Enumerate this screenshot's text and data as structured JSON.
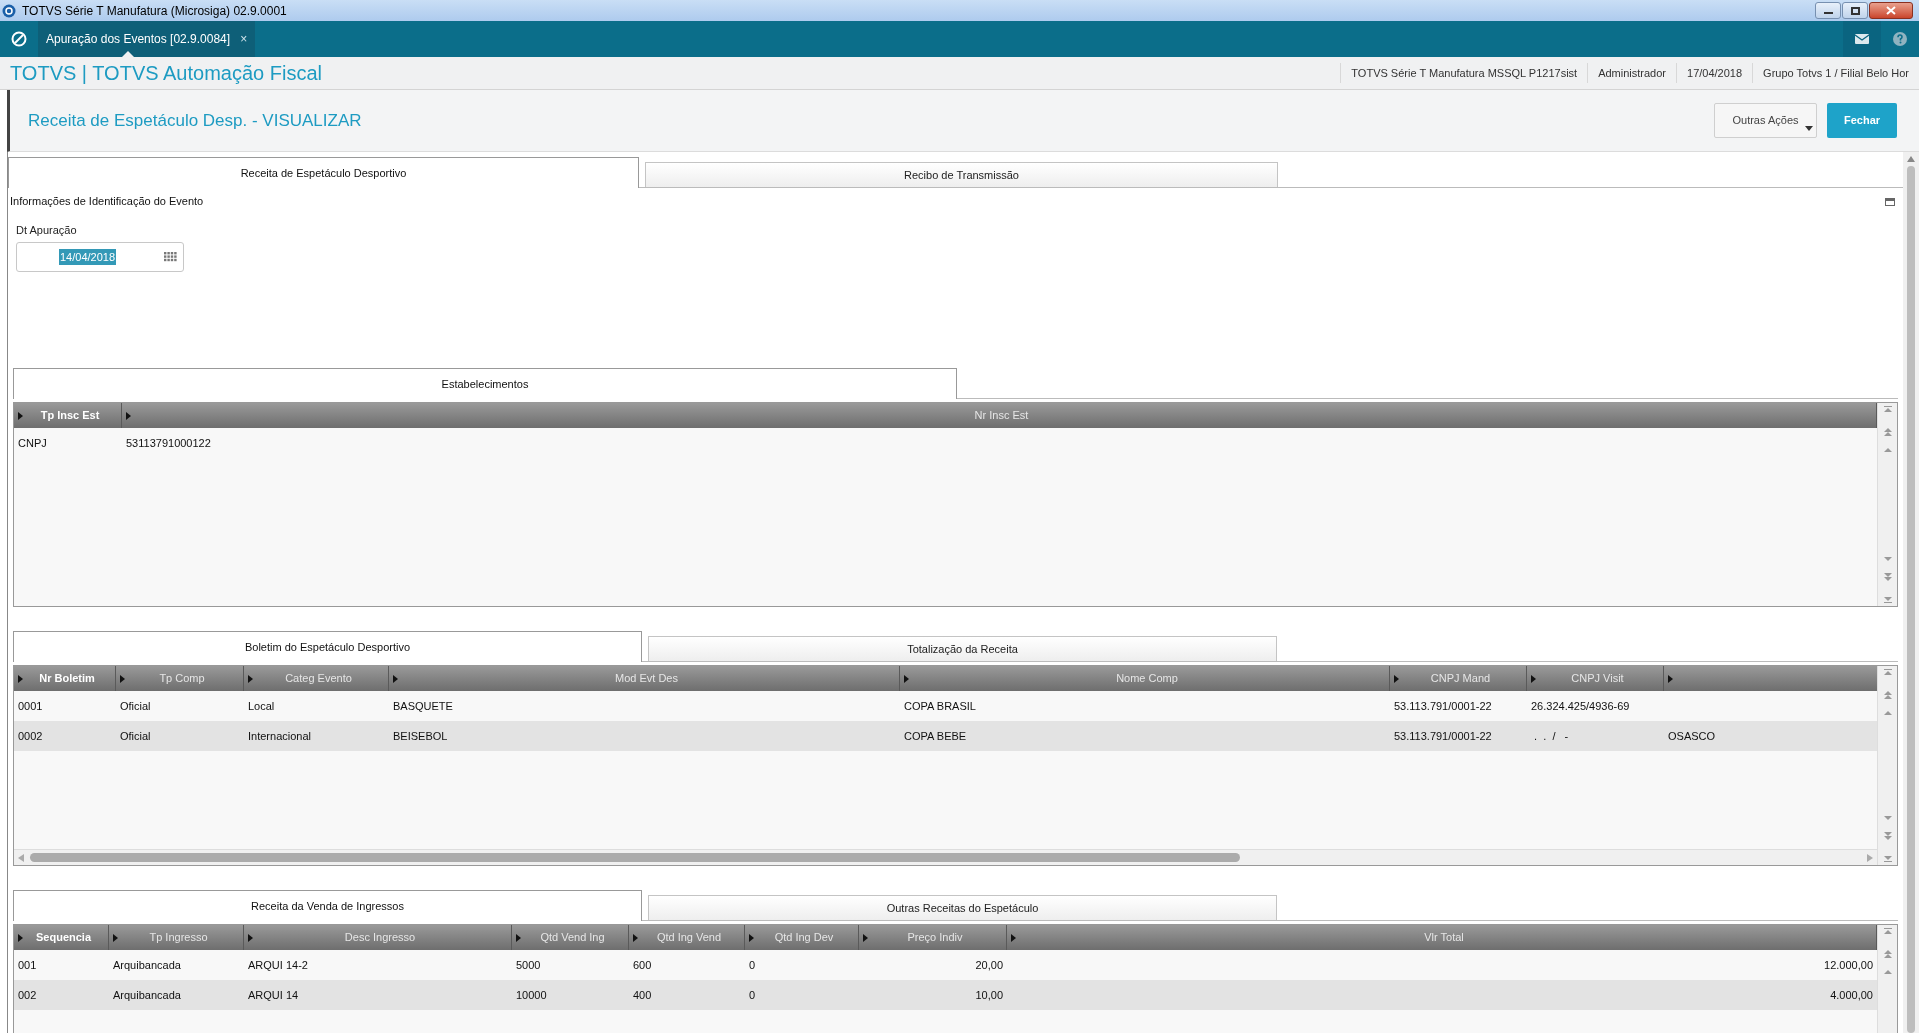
{
  "window": {
    "title": "TOTVS Série T Manufatura (Microsiga) 02.9.0001"
  },
  "app_tabs": [
    {
      "label": "Apuração dos Eventos [02.9.0084]",
      "selected": true,
      "close": "×"
    }
  ],
  "header": {
    "title": "TOTVS | TOTVS Automação Fiscal",
    "info": [
      "TOTVS Série T Manufatura MSSQL P1217sist",
      "Administrador",
      "17/04/2018",
      "Grupo Totvs 1 / Filial Belo Hor"
    ]
  },
  "page": {
    "title": "Receita de Espetáculo Desp. - VISUALIZAR",
    "buttons": [
      {
        "label": "Outras Ações",
        "kind": "menu"
      },
      {
        "label": "Fechar",
        "kind": "primary"
      }
    ]
  },
  "main_tabs": [
    {
      "label": "Receita de Espetáculo Desportivo",
      "selected": true
    },
    {
      "label": "Recibo de Transmissão",
      "selected": false
    }
  ],
  "section": {
    "title": "Informações de Identificação do Evento",
    "fields": [
      {
        "label": "Dt Apuração",
        "value": "14/04/2018",
        "highlighted": true
      }
    ]
  },
  "grids": [
    {
      "tabs": [
        {
          "label": "Estabelecimentos",
          "selected": true
        }
      ],
      "columns": [
        {
          "label": "Tp Insc Est",
          "sorted": true
        },
        {
          "label": "Nr Insc Est",
          "sorted": false
        }
      ],
      "rows": [
        [
          "CNPJ",
          "53113791000122"
        ]
      ]
    },
    {
      "tabs": [
        {
          "label": "Boletim do Espetáculo Desportivo",
          "selected": true
        },
        {
          "label": "Totalização da Receita",
          "selected": false
        }
      ],
      "columns": [
        {
          "label": "Nr Boletim",
          "sorted": true
        },
        {
          "label": "Tp Comp",
          "sorted": false
        },
        {
          "label": "Categ Evento",
          "sorted": false
        },
        {
          "label": "Mod Evt Des",
          "sorted": false
        },
        {
          "label": "Nome Comp",
          "sorted": false
        },
        {
          "label": "CNPJ Mand",
          "sorted": false
        },
        {
          "label": "CNPJ Visit",
          "sorted": false
        }
      ],
      "rows": [
        [
          "0001",
          "Oficial",
          "Local",
          "BASQUETE",
          "COPA BRASIL",
          "53.113.791/0001-22",
          "26.324.425/4936-69"
        ],
        [
          "0002",
          "Oficial",
          "Internacional",
          "BEISEBOL",
          "COPA BEBE",
          "53.113.791/0001-22",
          " .  .  /   -",
          "OSASCO"
        ]
      ]
    },
    {
      "tabs": [
        {
          "label": "Receita da Venda de Ingressos",
          "selected": true
        },
        {
          "label": "Outras Receitas do Espetáculo",
          "selected": false
        }
      ],
      "columns": [
        {
          "label": "Sequencia",
          "sorted": true
        },
        {
          "label": "Tp Ingresso",
          "sorted": false
        },
        {
          "label": "Desc Ingresso",
          "sorted": false
        },
        {
          "label": "Qtd Vend Ing",
          "sorted": false
        },
        {
          "label": "Qtd Ing Vend",
          "sorted": false
        },
        {
          "label": "Qtd Ing Dev",
          "sorted": false
        },
        {
          "label": "Preço Indiv",
          "sorted": false
        },
        {
          "label": "Vlr Total",
          "sorted": false
        }
      ],
      "rows": [
        [
          "001",
          "Arquibancada",
          "ARQUI 14-2",
          "5000",
          "600",
          "0",
          "20,00",
          "12.000,00"
        ],
        [
          "002",
          "Arquibancada",
          "ARQUI 14",
          "10000",
          "400",
          "0",
          "10,00",
          "4.000,00"
        ]
      ]
    }
  ]
}
